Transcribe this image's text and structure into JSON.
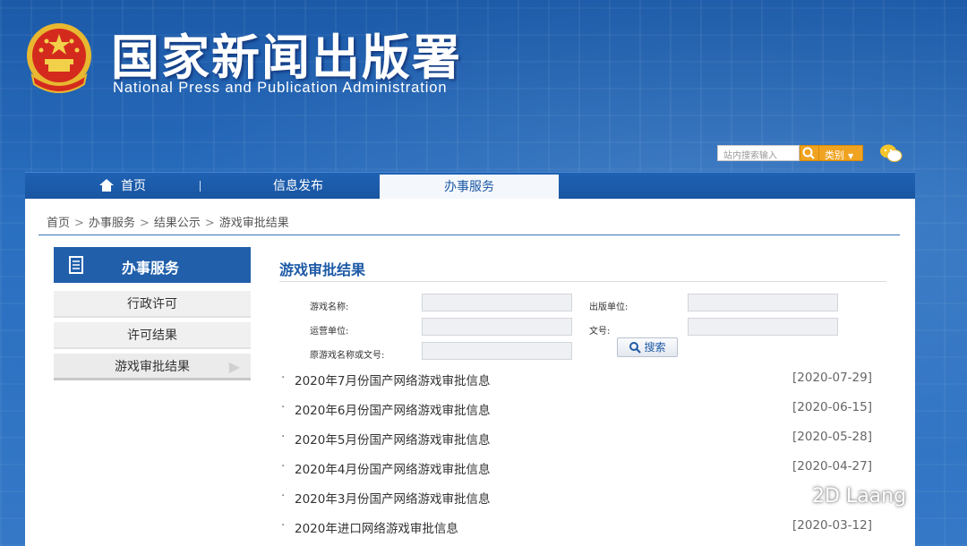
{
  "header": {
    "title": "国家新闻出版署",
    "subtitle": "National  Press and Publication Administration"
  },
  "search": {
    "placeholder": "站内搜索输入",
    "category_label": "类别"
  },
  "nav": {
    "home": "首页",
    "info": "信息发布",
    "service": "办事服务"
  },
  "breadcrumb": {
    "items": [
      "首页",
      "办事服务",
      "结果公示",
      "游戏审批结果"
    ]
  },
  "sidebar": {
    "heading": "办事服务",
    "items": [
      {
        "label": "行政许可"
      },
      {
        "label": "许可结果"
      },
      {
        "label": "游戏审批结果"
      }
    ]
  },
  "content": {
    "title": "游戏审批结果",
    "form": {
      "game_name_label": "游戏名称:",
      "publisher_label": "出版单位:",
      "operator_label": "运营单位:",
      "doc_no_label": "文号:",
      "original_label": "原游戏名称或文号:",
      "search_button": "搜索"
    },
    "list": [
      {
        "title": "2020年7月份国产网络游戏审批信息",
        "date": "[2020-07-29]"
      },
      {
        "title": "2020年6月份国产网络游戏审批信息",
        "date": "[2020-06-15]"
      },
      {
        "title": "2020年5月份国产网络游戏审批信息",
        "date": "[2020-05-28]"
      },
      {
        "title": "2020年4月份国产网络游戏审批信息",
        "date": "[2020-04-27]"
      },
      {
        "title": "2020年3月份国产网络游戏审批信息",
        "date": ""
      },
      {
        "title": "2020年进口网络游戏审批信息",
        "date": "[2020-03-12]"
      }
    ]
  },
  "watermark": "2D Laang",
  "colors": {
    "brand_blue": "#1d5aa6",
    "nav_bg": "#1f61b3",
    "search_orange": "#f0a320"
  }
}
